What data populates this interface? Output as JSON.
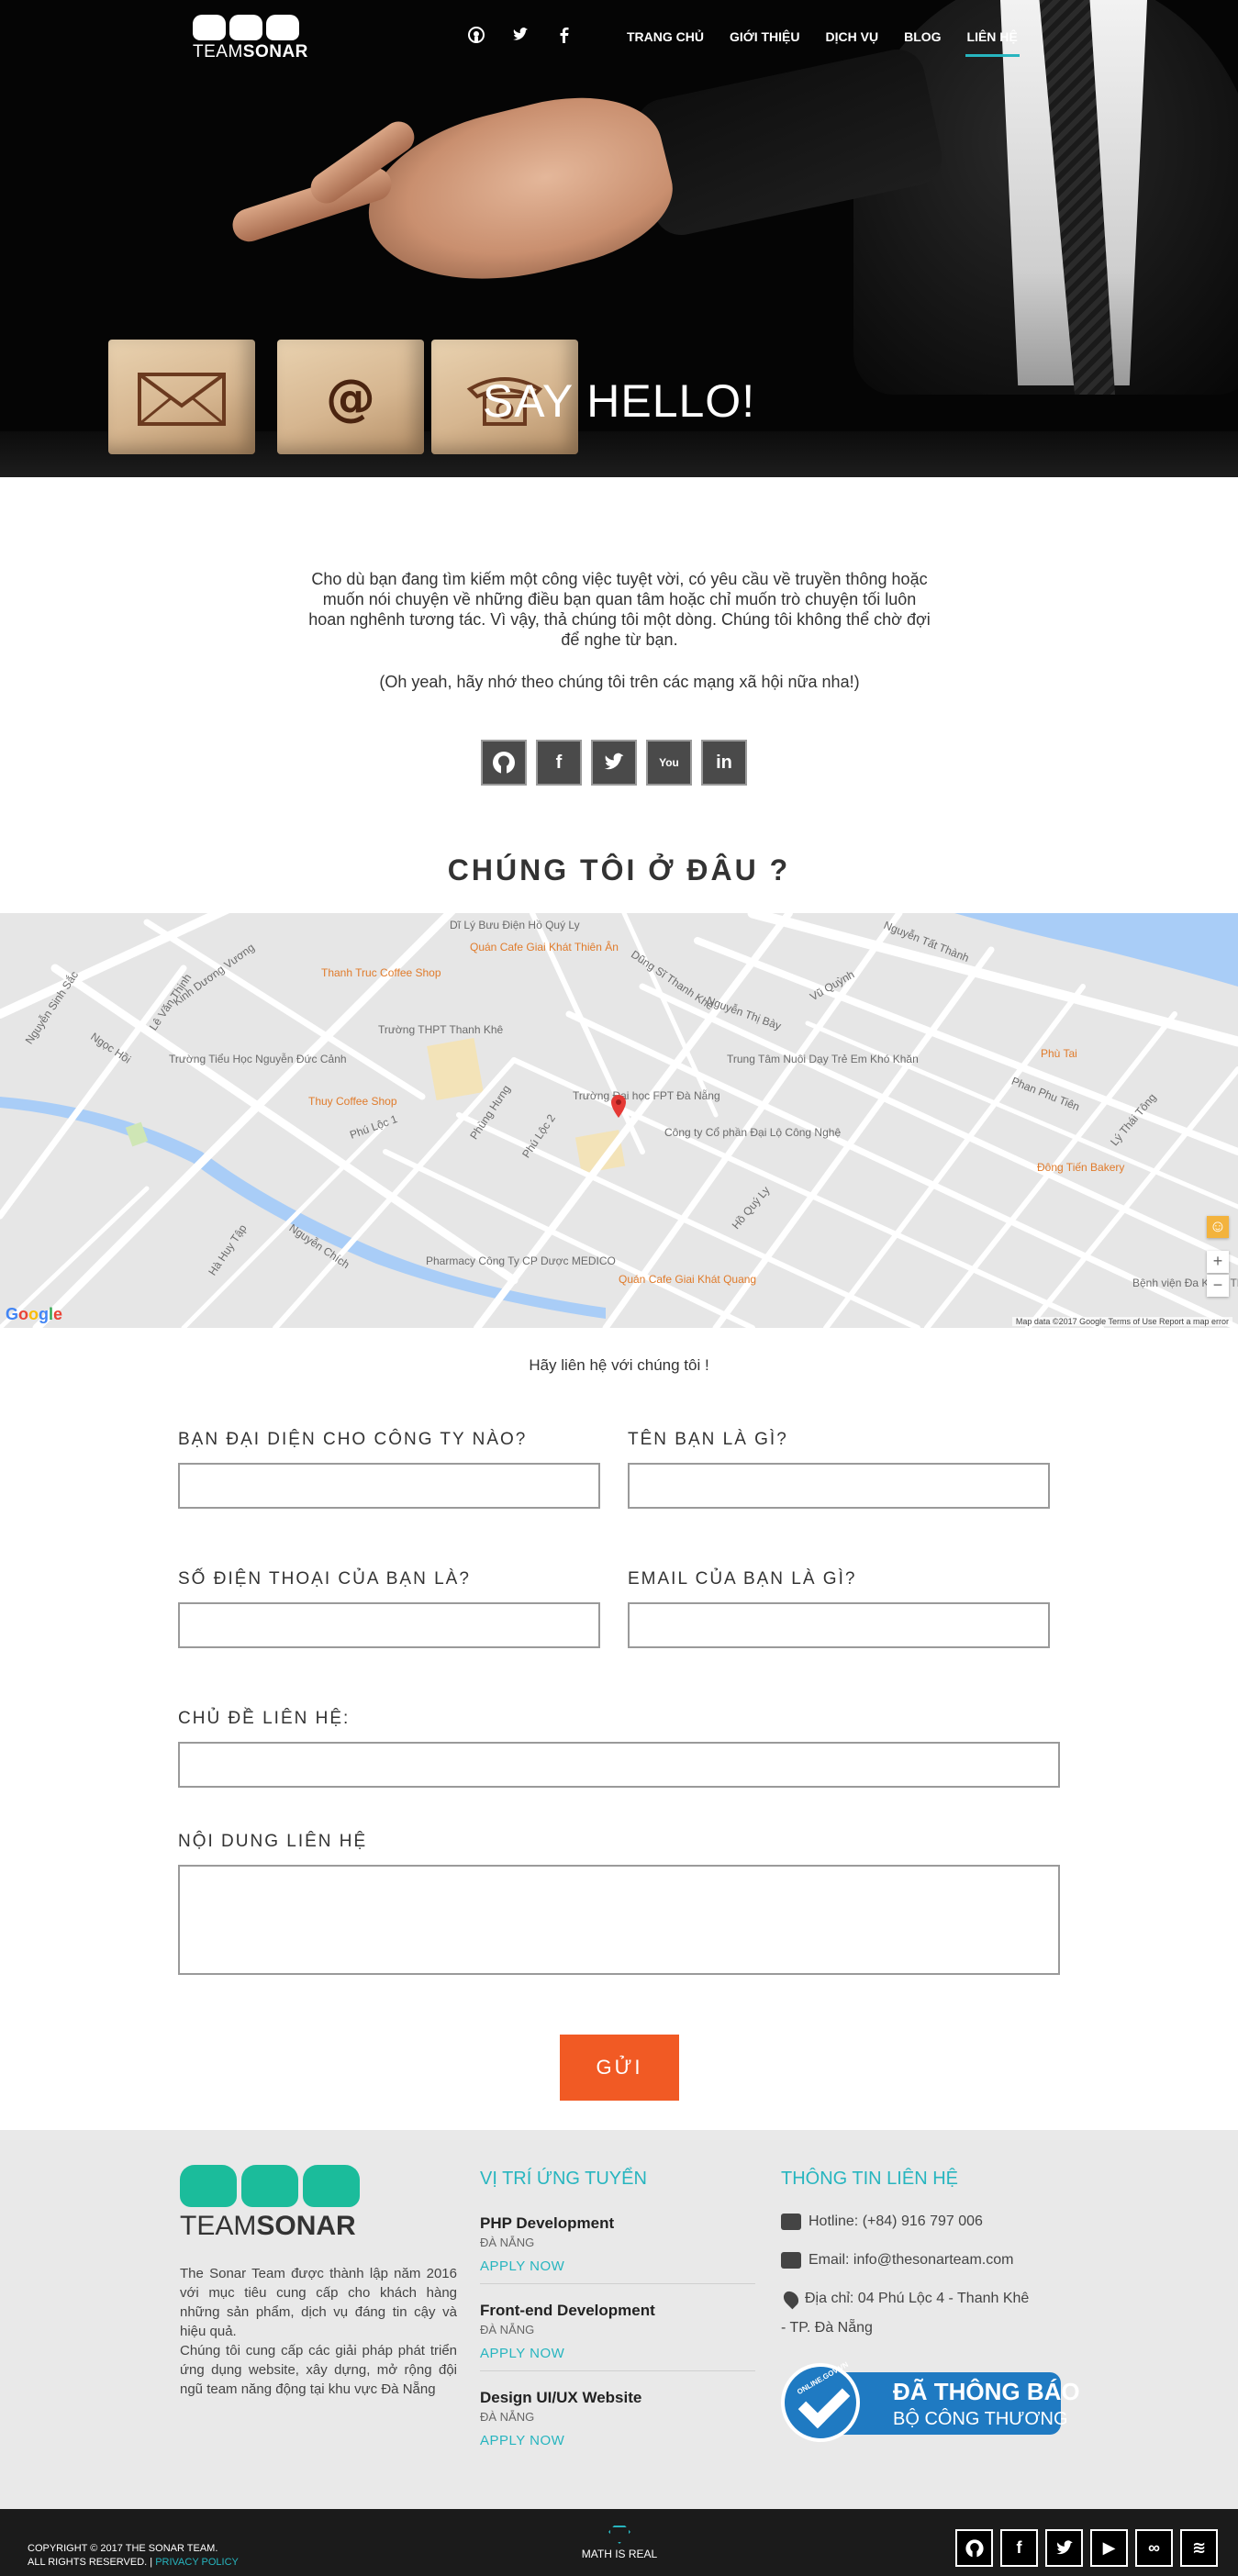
{
  "brand": {
    "logo_light": "TEAM",
    "logo_bold": "SONAR"
  },
  "nav": {
    "social": [
      "github-icon",
      "twitter-icon",
      "facebook-icon"
    ],
    "items": [
      {
        "label": "TRANG CHỦ",
        "active": false
      },
      {
        "label": "GIỚI THIỆU",
        "active": false
      },
      {
        "label": "DỊCH VỤ",
        "active": false
      },
      {
        "label": "BLOG",
        "active": false
      },
      {
        "label": "LIÊN HỆ",
        "active": true
      }
    ]
  },
  "hero": {
    "title": "SAY HELLO!"
  },
  "intro": {
    "text": "Cho dù bạn đang tìm kiếm một công việc tuyệt vời, có yêu cầu về truyền thông hoặc muốn nói chuyện về những điều bạn quan tâm hoặc chỉ muốn trò chuyện tối luôn hoan nghênh tương tác. Vì vậy, thả chúng tôi một dòng. Chúng tôi không thể chờ đợi để nghe từ bạn.",
    "note": "(Oh yeah, hãy nhớ theo chúng tôi trên các mạng xã hội nữa nha!)"
  },
  "social_mid": [
    {
      "icon": "github-icon",
      "glyph": "⌥"
    },
    {
      "icon": "facebook-icon",
      "glyph": "f"
    },
    {
      "icon": "twitter-icon",
      "glyph": "t"
    },
    {
      "icon": "youtube-icon",
      "glyph": "You"
    },
    {
      "icon": "linkedin-icon",
      "glyph": "in"
    }
  ],
  "map_section": {
    "title": "CHÚNG TÔI Ở ĐÂU ?",
    "labels": [
      "Dĩ Lý Bưu Điện Hồ Quý Ly",
      "Quán Cafe Giai Khát Thiên Ân",
      "Thanh Truc Coffee Shop",
      "Trường THPT Thanh Khê",
      "Trường Tiểu Học Nguyễn Đức Cảnh",
      "Thuy Coffee Shop",
      "Trường Đại học FPT Đà Nẵng",
      "Công ty Cổ phần Đại Lộ Công Nghệ",
      "Trung Tâm Nuôi Dạy Trẻ Em Khó Khăn",
      "Phù Tai",
      "Đông Tiến Bakery",
      "Bệnh viện Đa Khoa Thành Phố Đà Nẵng",
      "Pharmacy Công Ty CP Dược MEDICO",
      "Quán Cafe Giai Khát Quang",
      "Kinh Dương Vương",
      "Nguyễn Tất Thành",
      "Vũ Quỳnh",
      "Phan Phu Tiên",
      "Nguyễn Thị Bày",
      "Hồ Quý Ly",
      "Lý Thái Tông",
      "Dũng Sĩ Thanh Khê",
      "Ngọc Hồi",
      "Lê Văn Thịnh",
      "Nguyễn Sinh Sắc",
      "Phùng Hưng",
      "Phú Lộc 1",
      "Phú Lộc 2",
      "Nguyễn Chích",
      "Hà Huy Tập"
    ],
    "google": "Google",
    "mapdata": "Map data ©2017 Google   Terms of Use   Report a map error"
  },
  "form": {
    "heading": "Hãy liên hệ với chúng tôi !",
    "company_label": "BẠN ĐẠI DIỆN CHO CÔNG TY NÀO?",
    "name_label": "TÊN BẠN LÀ GÌ?",
    "phone_label": "SỐ ĐIỆN THOẠI CỦA BẠN LÀ?",
    "email_label": "EMAIL CỦA BẠN LÀ GÌ?",
    "subject_label": "CHỦ ĐỀ LIÊN HỆ:",
    "message_label": "NỘI DUNG LIÊN HỆ",
    "send_label": "GỬI"
  },
  "footer": {
    "logo_light": "TEAM",
    "logo_bold": "SONAR",
    "about_1": "The Sonar Team được thành lập năm 2016 với mục tiêu cung cấp cho khách hàng những sản phẩm, dịch vụ đáng tin cậy và hiệu quả.",
    "about_2": "Chúng tôi cung cấp các giải pháp phát triển ứng dụng website, xây dựng, mở rộng đội ngũ team năng động tại khu vực Đà Nẵng",
    "jobs_heading": "VỊ TRÍ ỨNG TUYỂN",
    "jobs": [
      {
        "title": "PHP Development",
        "city": "ĐÀ NẴNG",
        "apply": "APPLY NOW"
      },
      {
        "title": "Front-end Development",
        "city": "ĐÀ NẴNG",
        "apply": "APPLY NOW"
      },
      {
        "title": "Design UI/UX Website",
        "city": "ĐÀ NẴNG",
        "apply": "APPLY NOW"
      }
    ],
    "contact_heading": "THÔNG TIN LIÊN HỆ",
    "hotline": "Hotline: (+84) 916 797 006",
    "email": "Email: info@thesonarteam.com",
    "address_1": "Địa chỉ: 04 Phú Lộc 4 - Thanh Khê",
    "address_2": "- TP. Đà Nẵng",
    "badge_line1": "ĐÃ THÔNG BÁO",
    "badge_line2": "BỘ CÔNG THƯƠNG",
    "badge_online": "ONLINE.GOV.VN"
  },
  "bottom": {
    "copyright": "COPYRIGHT © 2017 THE SONAR TEAM.",
    "rights": "ALL RIGHTS RESERVED. |",
    "privacy": "PRIVACY POLICY",
    "tagline": "MATH IS REAL",
    "social": [
      {
        "icon": "github-icon",
        "glyph": "⌥"
      },
      {
        "icon": "facebook-icon",
        "glyph": "f"
      },
      {
        "icon": "twitter-icon",
        "glyph": "t"
      },
      {
        "icon": "youtube-icon",
        "glyph": "▶"
      },
      {
        "icon": "link-icon",
        "glyph": "∞"
      },
      {
        "icon": "wifi-icon",
        "glyph": "≋"
      }
    ]
  },
  "colors": {
    "accent": "#27b5bf",
    "button": "#f15a24",
    "footer_bg": "#e9e9e9",
    "bottom_bg": "#1b1b1b",
    "logo_green": "#1bbc9b"
  }
}
